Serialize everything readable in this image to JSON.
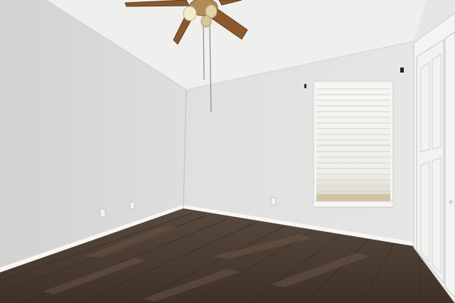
{
  "scene": {
    "description_tag": "empty-bedroom-photo",
    "colors": {
      "ceiling": "#efefed",
      "left_wall": "#d9d9d7",
      "back_wall": "#e3e3e1",
      "right_wall": "#e6e6e4",
      "baseboard": "#f6f6f4",
      "floor_base": "#4a3c32",
      "floor_light": "#6a5748",
      "closet_door": "#f2f2f0",
      "window_frame": "#f4f4f2",
      "blinds": "#ececea",
      "fan_blade": "#8a5a2e",
      "fan_body": "#b08a58",
      "fan_light": "#f4ead0"
    },
    "objects": [
      "ceiling-fan",
      "window-with-blinds",
      "closet-bifold-doors",
      "electrical-outlet",
      "wood-floor",
      "baseboard"
    ]
  }
}
